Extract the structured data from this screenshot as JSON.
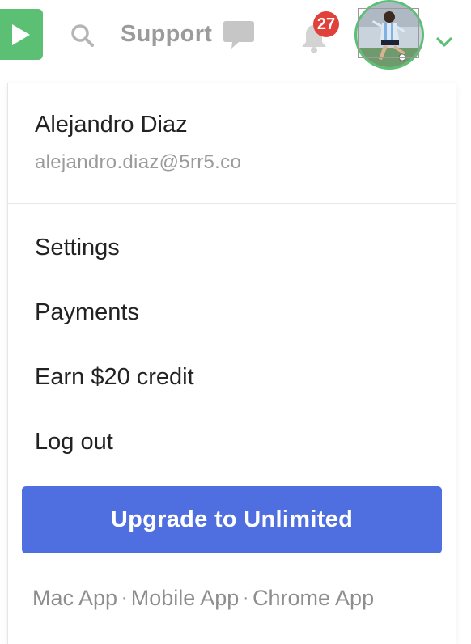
{
  "header": {
    "support_label": "Support",
    "notification_count": "27",
    "accent_color": "#5bbf74",
    "badge_color": "#e0413a",
    "icons": [
      "play-icon",
      "search-icon",
      "chat-icon",
      "bell-icon",
      "chevron-down-icon"
    ]
  },
  "dropdown": {
    "user_name": "Alejandro Diaz",
    "user_email": "alejandro.diaz@5rr5.co",
    "menu_items": [
      {
        "label": "Settings"
      },
      {
        "label": "Payments"
      },
      {
        "label": "Earn $20 credit"
      },
      {
        "label": "Log out"
      }
    ],
    "upgrade_label": "Upgrade to Unlimited",
    "upgrade_color": "#4f6ee0",
    "footer_links": [
      {
        "label": "Mac App"
      },
      {
        "label": "Mobile App"
      },
      {
        "label": "Chrome App"
      }
    ],
    "footer_separator": "·"
  }
}
